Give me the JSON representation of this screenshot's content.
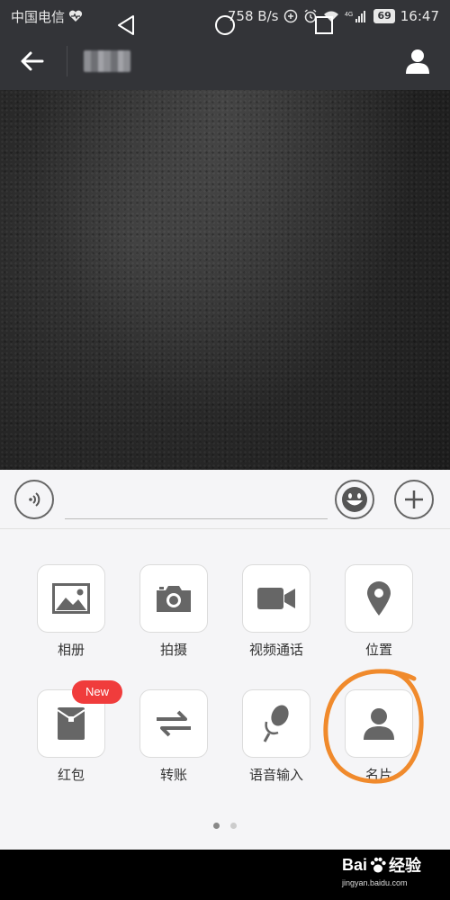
{
  "statusbar": {
    "carrier": "中国电信",
    "speed": "758 B/s",
    "network": "4G",
    "battery": "69",
    "time": "16:47"
  },
  "chat": {
    "input_placeholder": ""
  },
  "tools": [
    {
      "label": "相册",
      "icon": "photo-album-icon"
    },
    {
      "label": "拍摄",
      "icon": "camera-icon"
    },
    {
      "label": "视频通话",
      "icon": "video-call-icon"
    },
    {
      "label": "位置",
      "icon": "location-pin-icon"
    },
    {
      "label": "红包",
      "icon": "red-packet-icon",
      "badge": "New"
    },
    {
      "label": "转账",
      "icon": "transfer-icon"
    },
    {
      "label": "语音输入",
      "icon": "microphone-icon"
    },
    {
      "label": "名片",
      "icon": "contact-card-icon"
    }
  ],
  "pager": {
    "pages": 2,
    "current": 1
  },
  "watermark": {
    "brand_left": "Bai",
    "brand_right": "经验",
    "url": "jingyan.baidu.com"
  },
  "colors": {
    "bar": "#333438",
    "panel": "#f5f5f7",
    "icon": "#666666",
    "badge": "#f03c3c",
    "annotation": "#f08a2c"
  }
}
